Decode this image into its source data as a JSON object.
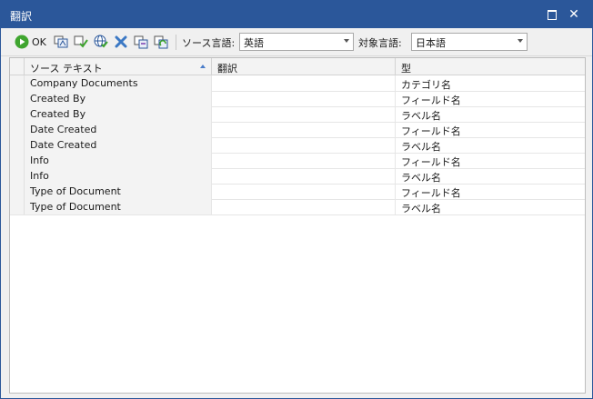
{
  "window": {
    "title": "翻訳"
  },
  "toolbar": {
    "ok_label": "OK",
    "source_lang_label": "ソース言語:",
    "source_lang_value": "英語",
    "target_lang_label": "対象言語:",
    "target_lang_value": "日本語"
  },
  "grid": {
    "columns": [
      "ソース テキスト",
      "翻訳",
      "型"
    ],
    "rows": [
      {
        "source": "Company Documents",
        "translation": "",
        "type": "カテゴリ名"
      },
      {
        "source": "Created By",
        "translation": "",
        "type": "フィールド名"
      },
      {
        "source": "Created By",
        "translation": "",
        "type": "ラベル名"
      },
      {
        "source": "Date Created",
        "translation": "",
        "type": "フィールド名"
      },
      {
        "source": "Date Created",
        "translation": "",
        "type": "ラベル名"
      },
      {
        "source": "Info",
        "translation": "",
        "type": "フィールド名"
      },
      {
        "source": "Info",
        "translation": "",
        "type": "ラベル名"
      },
      {
        "source": "Type of Document",
        "translation": "",
        "type": "フィールド名"
      },
      {
        "source": "Type of Document",
        "translation": "",
        "type": "ラベル名"
      }
    ]
  },
  "colors": {
    "titlebar": "#2b579a",
    "ok_icon": "#3fa52f",
    "delete_icon": "#3b78c4"
  }
}
